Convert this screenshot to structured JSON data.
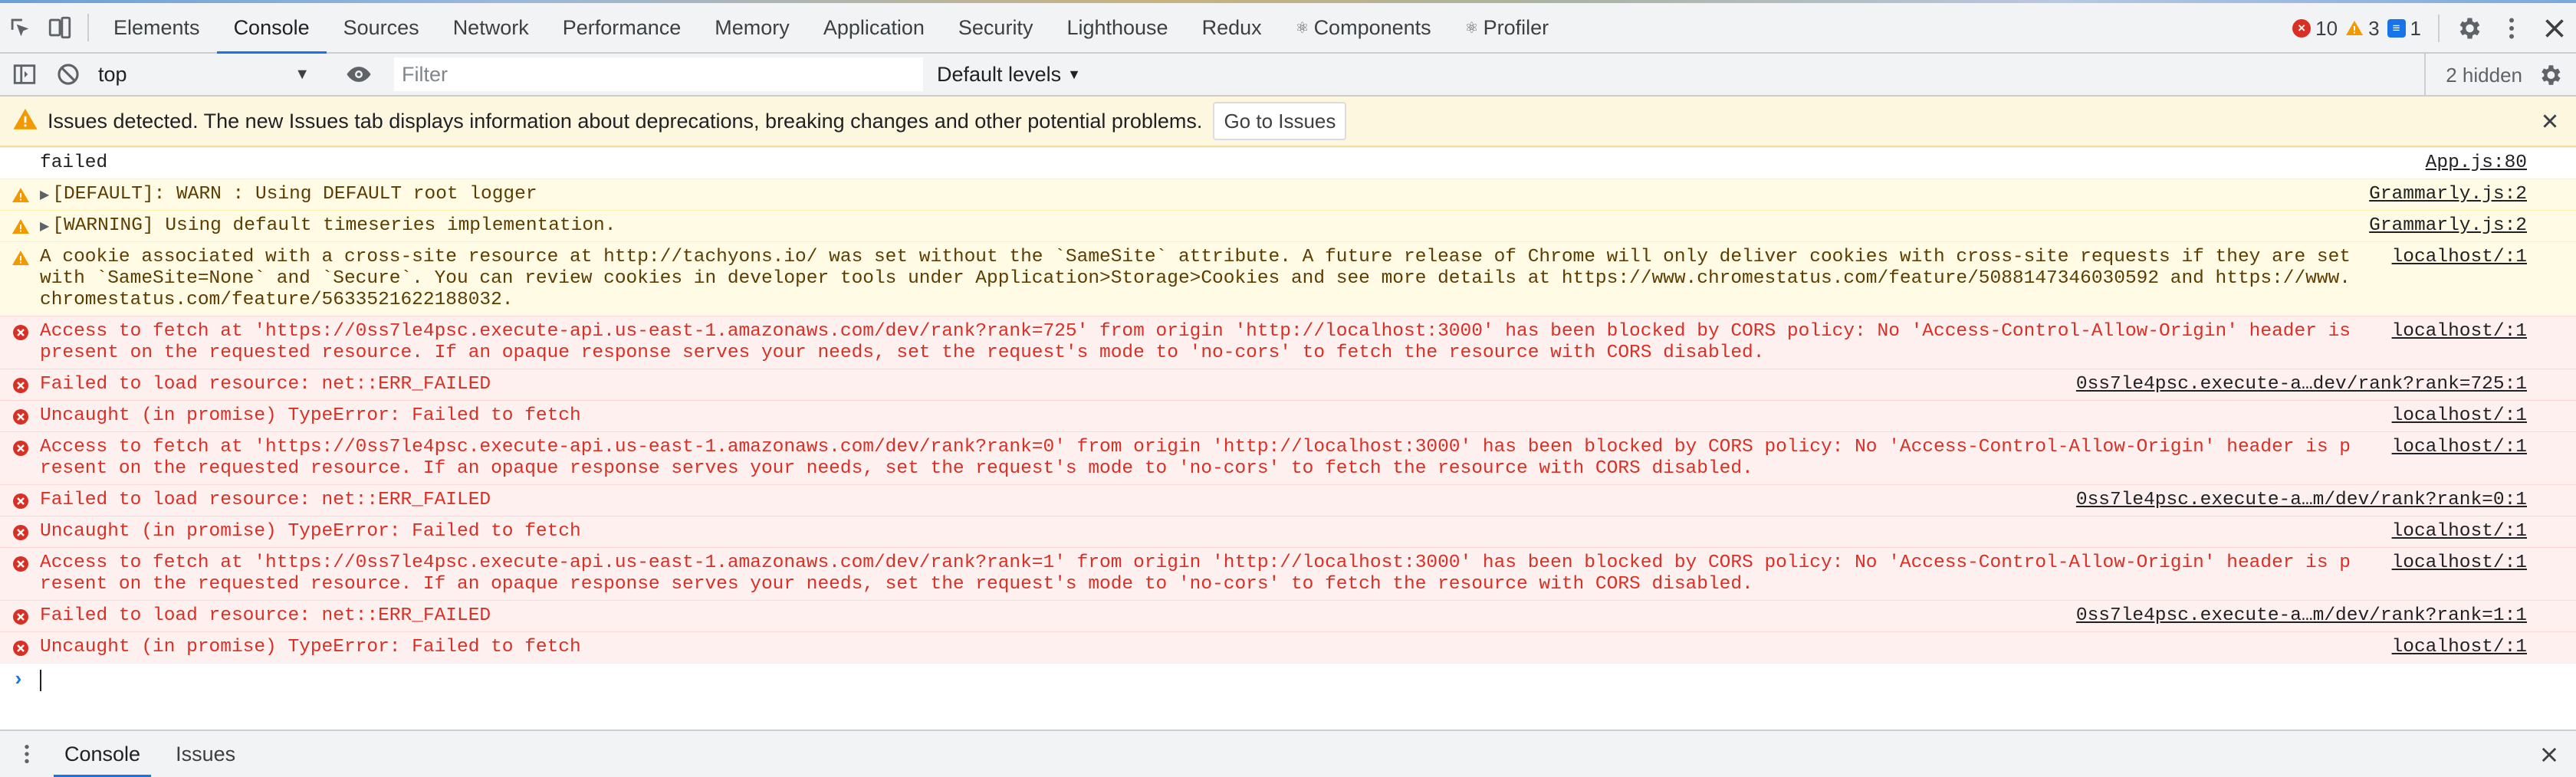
{
  "tabs": [
    "Elements",
    "Console",
    "Sources",
    "Network",
    "Performance",
    "Memory",
    "Application",
    "Security",
    "Lighthouse",
    "Redux",
    "Components",
    "Profiler"
  ],
  "active_tab": "Console",
  "counters": {
    "errors": "10",
    "warnings": "3",
    "info": "1"
  },
  "toolbar": {
    "context": "top",
    "filter_placeholder": "Filter",
    "levels": "Default levels",
    "hidden": "2 hidden"
  },
  "banner": {
    "message": "Issues detected. The new Issues tab displays information about deprecations, breaking changes and other potential problems.",
    "button": "Go to Issues"
  },
  "messages": [
    {
      "level": "plain",
      "text": "failed",
      "source": "App.js:80"
    },
    {
      "level": "warn",
      "expand": true,
      "text": "[DEFAULT]: WARN : Using DEFAULT root logger",
      "source": "Grammarly.js:2"
    },
    {
      "level": "warn",
      "expand": true,
      "text": "[WARNING] Using default timeseries implementation.",
      "source": "Grammarly.js:2"
    },
    {
      "level": "warn",
      "text": "A cookie associated with a cross-site resource at http://tachyons.io/ was set without the `SameSite` attribute. A future release of Chrome will only deliver cookies with cross-site requests if they are set with `SameSite=None` and `Secure`. You can review cookies in developer tools under Application>Storage>Cookies and see more details at https://www.chromestatus.com/feature/5088147346030592 and https://www.chromestatus.com/feature/5633521622188032.",
      "source": "localhost/:1"
    },
    {
      "level": "error",
      "text": "Access to fetch at 'https://0ss7le4psc.execute-api.us-east-1.amazonaws.com/dev/rank?rank=725' from origin 'http://localhost:3000' has been blocked by CORS policy: No 'Access-Control-Allow-Origin' header is present on the requested resource. If an opaque response serves your needs, set the request's mode to 'no-cors' to fetch the resource with CORS disabled.",
      "source": "localhost/:1"
    },
    {
      "level": "error",
      "text": "Failed to load resource: net::ERR_FAILED",
      "source": "0ss7le4psc.execute-a…dev/rank?rank=725:1"
    },
    {
      "level": "error",
      "text": "Uncaught (in promise) TypeError: Failed to fetch",
      "source": "localhost/:1"
    },
    {
      "level": "error",
      "text": "Access to fetch at 'https://0ss7le4psc.execute-api.us-east-1.amazonaws.com/dev/rank?rank=0' from origin 'http://localhost:3000' has been blocked by CORS policy: No 'Access-Control-Allow-Origin' header is present on the requested resource. If an opaque response serves your needs, set the request's mode to 'no-cors' to fetch the resource with CORS disabled.",
      "source": "localhost/:1"
    },
    {
      "level": "error",
      "text": "Failed to load resource: net::ERR_FAILED",
      "source": "0ss7le4psc.execute-a…m/dev/rank?rank=0:1"
    },
    {
      "level": "error",
      "text": "Uncaught (in promise) TypeError: Failed to fetch",
      "source": "localhost/:1"
    },
    {
      "level": "error",
      "text": "Access to fetch at 'https://0ss7le4psc.execute-api.us-east-1.amazonaws.com/dev/rank?rank=1' from origin 'http://localhost:3000' has been blocked by CORS policy: No 'Access-Control-Allow-Origin' header is present on the requested resource. If an opaque response serves your needs, set the request's mode to 'no-cors' to fetch the resource with CORS disabled.",
      "source": "localhost/:1"
    },
    {
      "level": "error",
      "text": "Failed to load resource: net::ERR_FAILED",
      "source": "0ss7le4psc.execute-a…m/dev/rank?rank=1:1"
    },
    {
      "level": "error",
      "text": "Uncaught (in promise) TypeError: Failed to fetch",
      "source": "localhost/:1"
    }
  ],
  "drawer": {
    "tabs": [
      "Console",
      "Issues"
    ],
    "active": "Console"
  },
  "colors": {
    "accent": "#1a73e8",
    "error": "#d93025",
    "warning": "#f29900"
  }
}
